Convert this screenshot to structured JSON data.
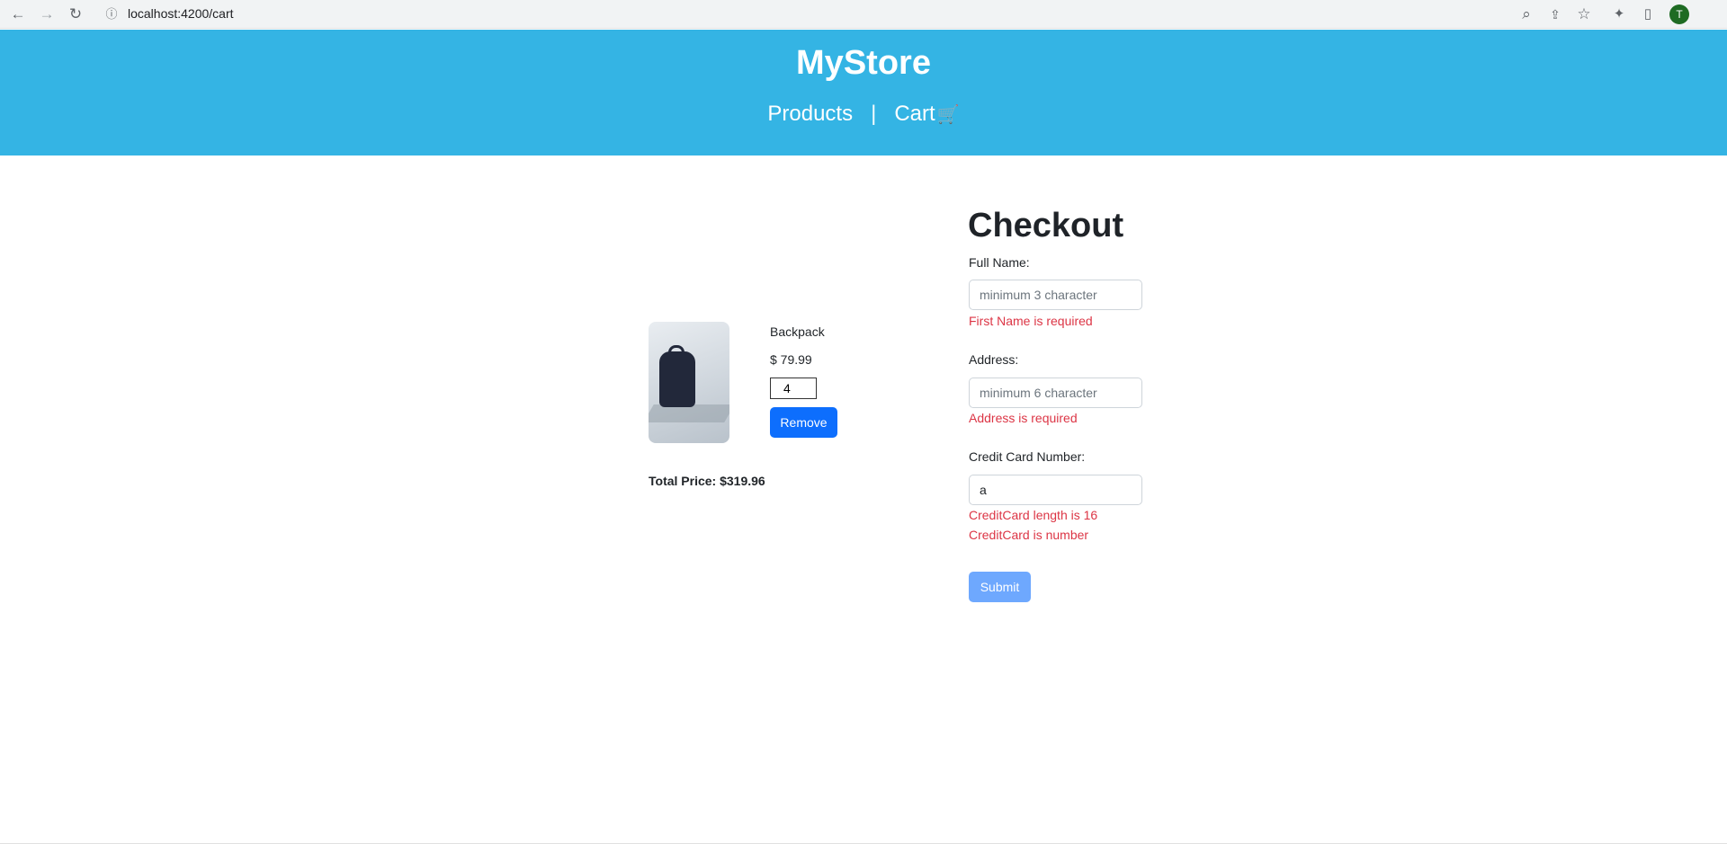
{
  "browser": {
    "url": "localhost:4200/cart",
    "icons": [
      "back-arrow-icon",
      "forward-arrow-icon",
      "reload-icon",
      "info-icon",
      "zoom-icon",
      "share-icon",
      "star-icon",
      "extensions-icon",
      "sidepanel-icon"
    ],
    "avatar_letter": "T"
  },
  "header": {
    "brand": "MyStore",
    "nav": {
      "products": "Products",
      "separator": "|",
      "cart": "Cart",
      "cart_icon": "🛒"
    }
  },
  "cart": {
    "item": {
      "name": "Backpack",
      "price": "$ 79.99",
      "quantity": "4",
      "remove_label": "Remove"
    },
    "total": "Total Price: $319.96"
  },
  "checkout": {
    "title": "Checkout",
    "full_name": {
      "label": "Full Name:",
      "placeholder": "minimum 3 character",
      "value": "",
      "error": "First Name is required"
    },
    "address": {
      "label": "Address:",
      "placeholder": "minimum 6 character",
      "value": "",
      "error": "Address is required"
    },
    "credit_card": {
      "label": "Credit Card Number:",
      "value": "a",
      "errors": [
        "CreditCard length is 16",
        "CreditCard is number"
      ]
    },
    "submit_label": "Submit"
  },
  "colors": {
    "header_bg": "#34b4e4",
    "primary": "#0d6efd",
    "primary_disabled": "#6ea8fe",
    "error": "#dc3545"
  }
}
